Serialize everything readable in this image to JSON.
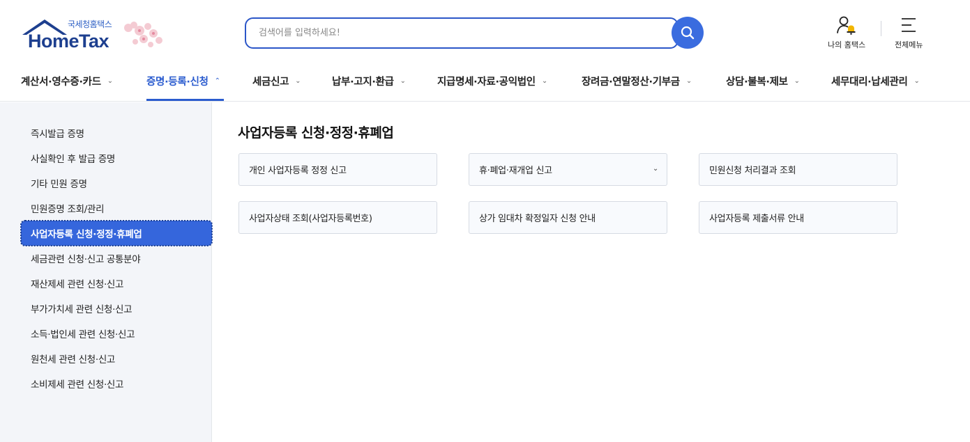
{
  "brand": {
    "logo_small": "국세청홈택스",
    "logo_big": "HomeTax",
    "primary_color": "#2b5ccf",
    "dark_color": "#1d3f8f"
  },
  "search": {
    "placeholder": "검색어를 입력하세요!",
    "icon": "search-icon"
  },
  "utility": {
    "my_hometax": "나의 홈택스",
    "all_menu": "전체메뉴"
  },
  "gnb": {
    "items": [
      {
        "label": "계산서·영수증·카드"
      },
      {
        "label": "증명·등록·신청",
        "active": true
      },
      {
        "label": "세금신고"
      },
      {
        "label": "납부·고지·환급"
      },
      {
        "label": "지급명세·자료·공익법인"
      },
      {
        "label": "장려금·연말정산·기부금"
      },
      {
        "label": "상담·불복·제보"
      },
      {
        "label": "세무대리·납세관리"
      }
    ]
  },
  "sidebar": {
    "items": [
      {
        "label": "즉시발급 증명"
      },
      {
        "label": "사실확인 후 발급 증명"
      },
      {
        "label": "기타 민원 증명"
      },
      {
        "label": "민원증명 조회/관리"
      },
      {
        "label": "사업자등록 신청·정정·휴폐업",
        "active": true
      },
      {
        "label": "세금관련 신청·신고 공통분야"
      },
      {
        "label": "재산제세 관련 신청·신고"
      },
      {
        "label": "부가가치세 관련 신청·신고"
      },
      {
        "label": "소득·법인세 관련 신청·신고"
      },
      {
        "label": "원천세 관련 신청·신고"
      },
      {
        "label": "소비제세 관련 신청·신고"
      }
    ]
  },
  "main": {
    "title": "사업자등록 신청·정정·휴폐업",
    "cards": [
      {
        "label": "개인 사업자등록 정정 신고"
      },
      {
        "label": "휴·폐업·재개업 신고",
        "has_dropdown": true
      },
      {
        "label": "민원신청 처리결과 조회"
      },
      {
        "label": "사업자상태 조회(사업자등록번호)"
      },
      {
        "label": "상가 임대차 확정일자 신청 안내"
      },
      {
        "label": "사업자등록 제출서류 안내"
      }
    ]
  }
}
